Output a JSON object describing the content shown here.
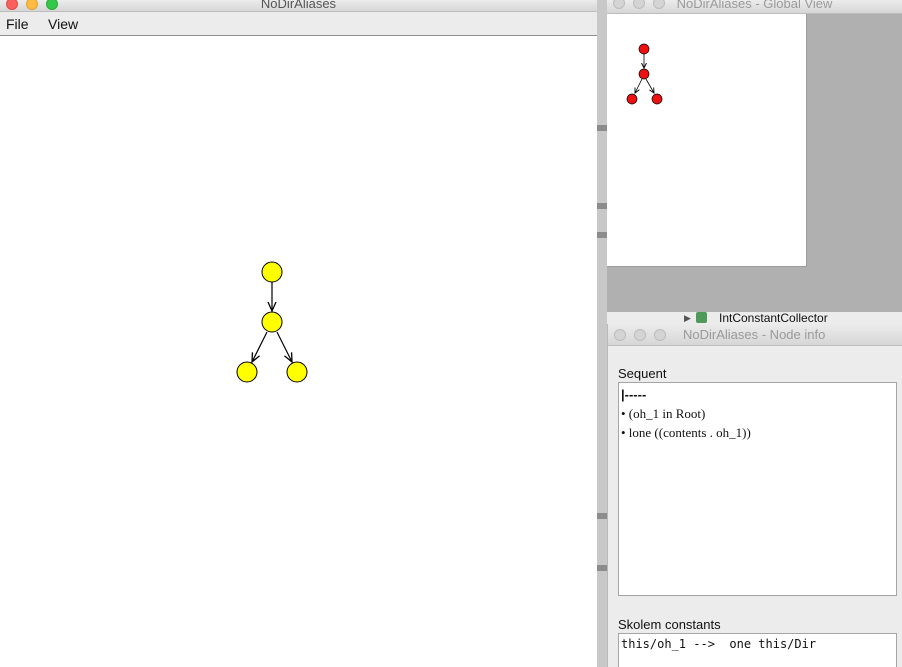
{
  "main_window": {
    "title": "NoDirAliases",
    "menu": [
      "File",
      "View"
    ]
  },
  "global_view": {
    "title": "NoDirAliases - Global View"
  },
  "background": {
    "tree_item": "IntConstantCollector"
  },
  "node_info": {
    "title": "NoDirAliases - Node info",
    "sequent_label": "Sequent",
    "sequent_lines": [
      "|-----",
      "• (oh_1 in Root)",
      "• lone ((contents . oh_1))"
    ],
    "skolem_label": "Skolem constants",
    "skolem_lines": [
      "this/oh_1 -->  one this/Dir"
    ]
  },
  "colors": {
    "node_main": "#ffff00",
    "node_global": "#ee1111"
  }
}
